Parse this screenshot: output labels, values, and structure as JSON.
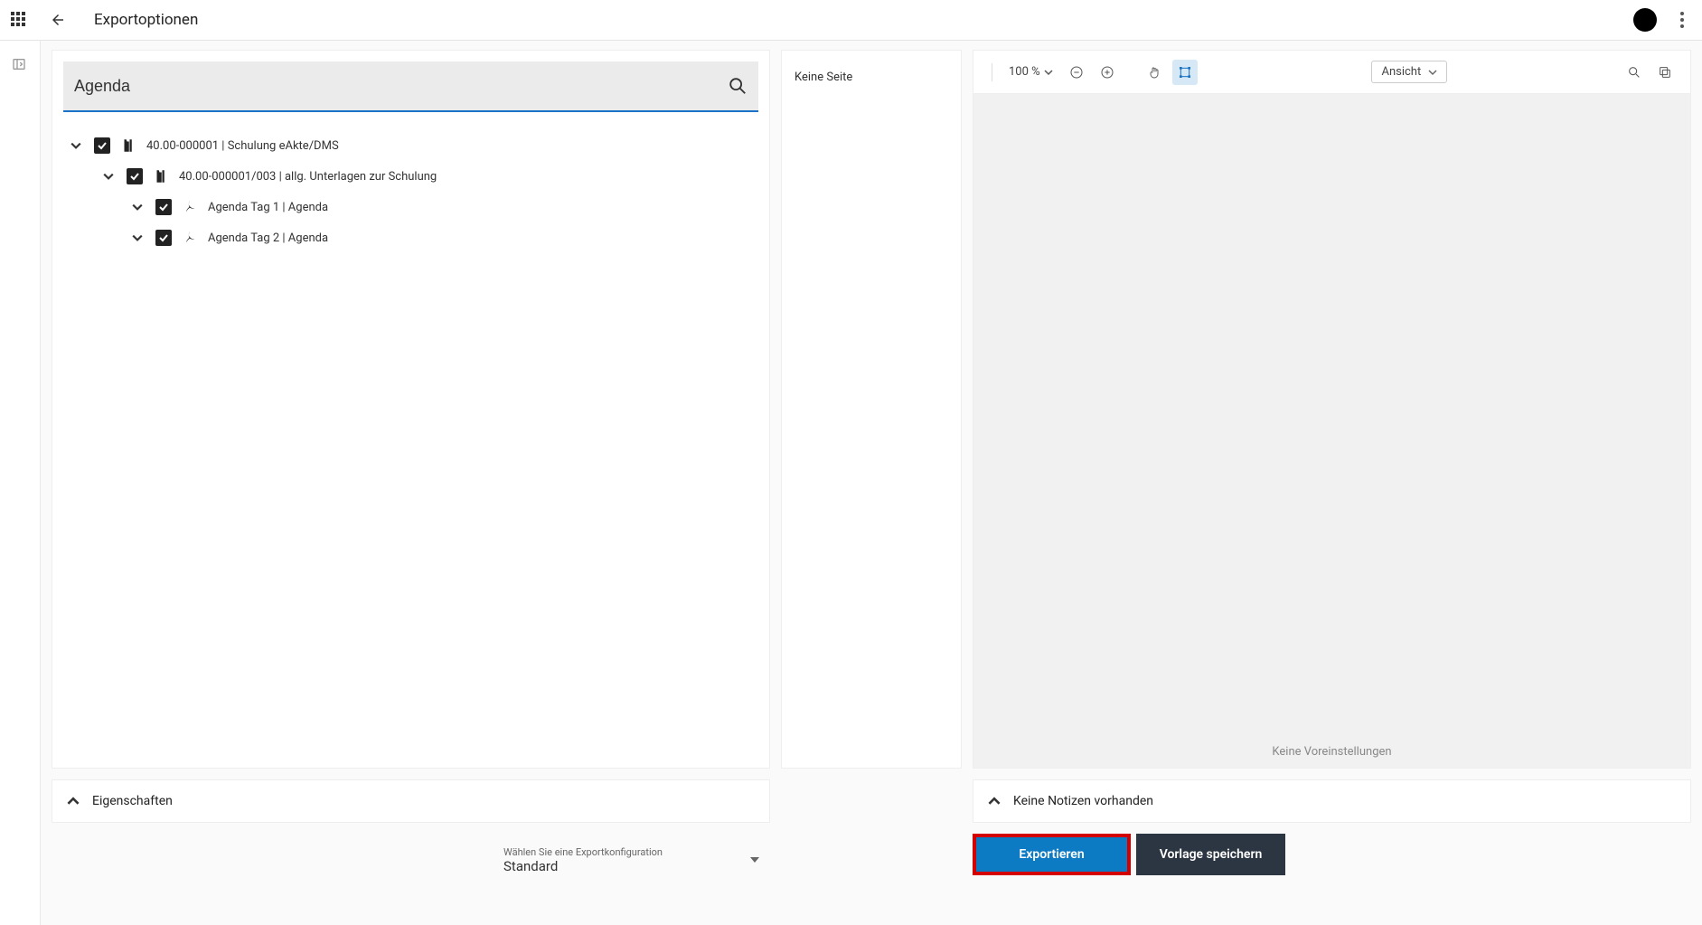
{
  "header": {
    "title": "Exportoptionen"
  },
  "search": {
    "value": "Agenda"
  },
  "tree": [
    {
      "indent": 0,
      "icon": "folder",
      "label": "40.00-000001 | Schulung eAkte/DMS"
    },
    {
      "indent": 1,
      "icon": "folder",
      "label": "40.00-000001/003 | allg. Unterlagen zur Schulung"
    },
    {
      "indent": 2,
      "icon": "pdf",
      "label": "Agenda Tag 1 | Agenda"
    },
    {
      "indent": 2,
      "icon": "pdf",
      "label": "Agenda Tag 2 | Agenda"
    }
  ],
  "middle": {
    "no_page": "Keine Seite"
  },
  "preview": {
    "zoom": "100 %",
    "view_label": "Ansicht",
    "no_presets": "Keine Voreinstellungen"
  },
  "accordions": {
    "properties": "Eigenschaften",
    "no_notes": "Keine Notizen vorhanden"
  },
  "footer": {
    "config_label": "Wählen Sie eine Exportkonfiguration",
    "config_value": "Standard",
    "export_btn": "Exportieren",
    "save_template_btn": "Vorlage speichern"
  }
}
